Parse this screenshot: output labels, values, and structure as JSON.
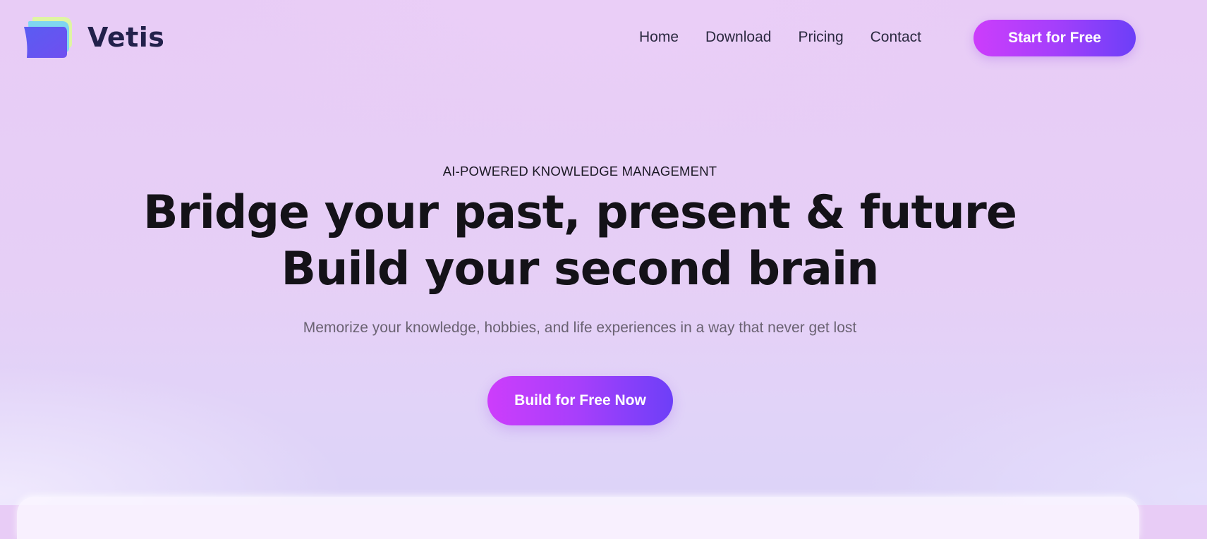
{
  "brand": {
    "name": "Vetis",
    "logo_icon": "layered-pages-logo-icon",
    "text_color": "#22214b"
  },
  "nav": {
    "links": [
      {
        "label": "Home"
      },
      {
        "label": "Download"
      },
      {
        "label": "Pricing"
      },
      {
        "label": "Contact"
      }
    ],
    "cta_label": "Start for Free"
  },
  "hero": {
    "eyebrow": "AI-POWERED KNOWLEDGE MANAGEMENT",
    "headline_line1": "Bridge your past, present & future",
    "headline_line2": "Build your second brain",
    "subtitle": "Memorize your knowledge, hobbies, and life experiences in a way that never get lost",
    "cta_label": "Build for Free Now"
  },
  "colors": {
    "background": "#e8ccf6",
    "accent_gradient_start": "#cc3dfb",
    "accent_gradient_end": "#6c3ff8",
    "headline": "#141218",
    "subtitle": "#6a6272"
  }
}
